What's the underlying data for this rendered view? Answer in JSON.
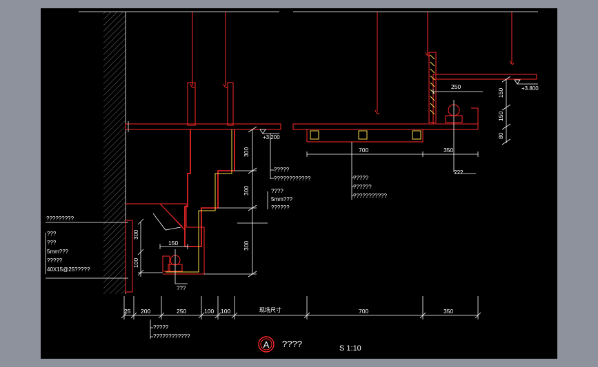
{
  "window": {
    "background": "#8e929c",
    "canvas_color": "#000000"
  },
  "colors": {
    "line": "#ffffff",
    "accent": "#ff2a2a",
    "highlight": "#ffe14a"
  },
  "elevations": {
    "left": "+3.200",
    "right": "+3.800"
  },
  "left_detail": {
    "vertical_dims": [
      "300",
      "300",
      "300"
    ],
    "notes_upper": [
      "?????",
      "????????????"
    ],
    "notes_mid": [
      "????",
      "5mm???",
      "??????"
    ],
    "notes_left_title": "?????????",
    "notes_left": [
      "???",
      "???",
      "5mm???",
      "?????",
      "40X15@25?????"
    ],
    "vert_dims_small": [
      "300",
      "100"
    ],
    "dim_150": "150",
    "lamp_label": "???"
  },
  "right_detail": {
    "dim_250": "250",
    "dims_vertical": [
      "150",
      "150",
      "80"
    ],
    "dim_700": "700",
    "dim_350": "350",
    "notes": [
      "?????",
      "??????",
      "???????????"
    ],
    "lamp_label": "???"
  },
  "bottom_dims": {
    "values": [
      "25",
      "200",
      "250",
      "100",
      "100",
      "700",
      "350"
    ],
    "label": "现场尺寸",
    "notes": [
      "?????",
      "????????????"
    ]
  },
  "title_block": {
    "marker": "A",
    "title": "????",
    "scale": "S 1:10"
  }
}
